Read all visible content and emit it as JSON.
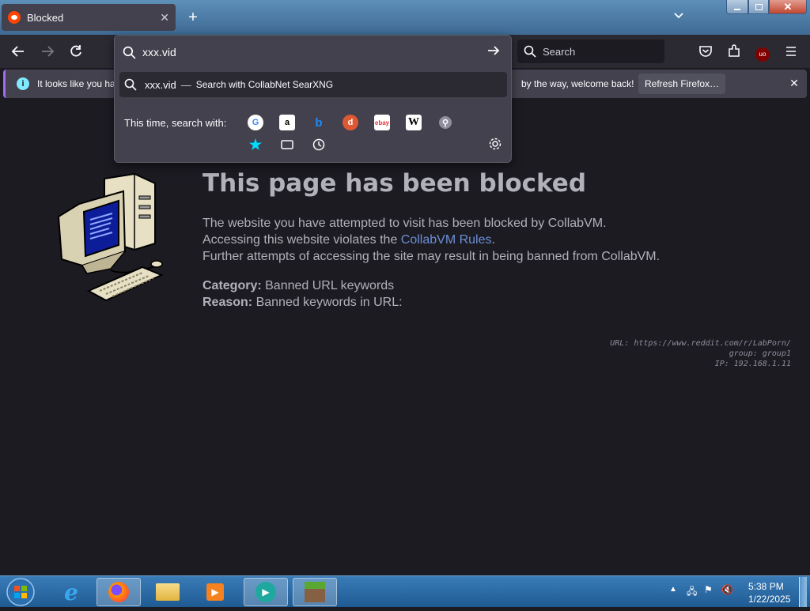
{
  "window": {
    "tab_title": "Blocked",
    "tab_close": "✕",
    "new_tab": "+",
    "tab_list": "⌄"
  },
  "nav": {
    "search_placeholder": "Search"
  },
  "urlbar": {
    "value": "xxx.vid",
    "suggestion_query": "xxx.vid",
    "suggestion_sep": "—",
    "suggestion_action": "Search with CollabNet SearXNG",
    "this_time_label": "This time, search with:",
    "engines": [
      "google",
      "amazon",
      "bing",
      "duckduckgo",
      "ebay",
      "wikipedia",
      "searxng",
      "bookmarks",
      "tabs",
      "history"
    ]
  },
  "infobar": {
    "text_left": "It looks like you ha",
    "text_right": "by the way, welcome back!",
    "refresh_label": "Refresh Firefox…",
    "close": "✕"
  },
  "page": {
    "heading": "This page has been blocked",
    "line1": "The website you have attempted to visit has been blocked by CollabVM.",
    "line2_prefix": "Accessing this website violates the ",
    "line2_link": "CollabVM Rules",
    "line2_suffix": ".",
    "line3": "Further attempts of accessing the site may result in being banned from CollabVM.",
    "category_label": "Category:",
    "category_value": " Banned URL keywords",
    "reason_label": "Reason:",
    "reason_value": " Banned keywords in URL:",
    "meta_url": "URL: https://www.reddit.com/r/LabPorn/",
    "meta_group": "group: group1",
    "meta_ip": "IP: 192.168.1.11"
  },
  "taskbar": {
    "apps": [
      "internet-explorer",
      "firefox",
      "file-explorer",
      "media-player",
      "video-app",
      "minecraft"
    ],
    "time": "5:38 PM",
    "date": "1/22/2025"
  },
  "colors": {
    "accent": "#a26bf0",
    "link": "#6c8fd6",
    "page_bg": "#1c1b22",
    "text": "#b1b1b9"
  }
}
